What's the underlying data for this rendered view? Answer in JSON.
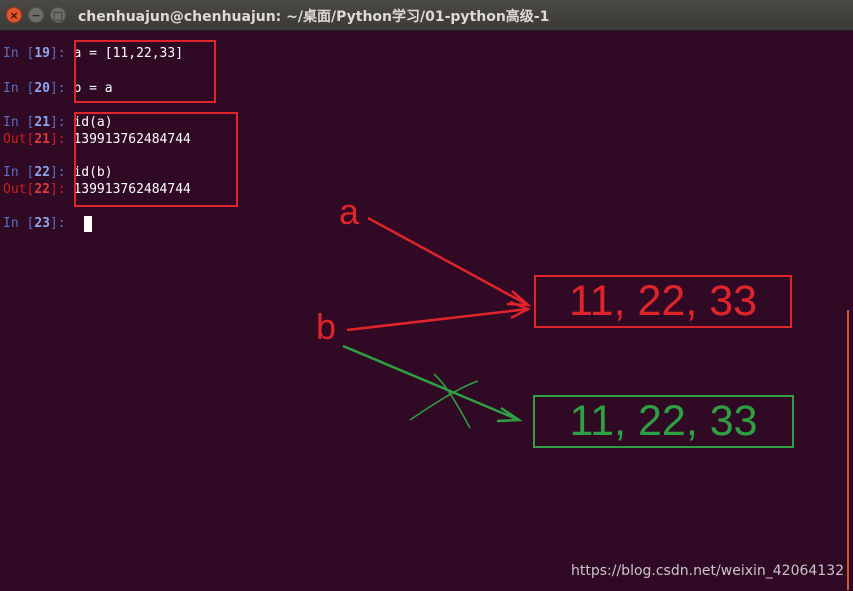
{
  "window": {
    "title": "chenhuajun@chenhuajun: ~/桌面/Python学习/01-python高级-1",
    "close_glyph": "×",
    "min_glyph": "−",
    "max_glyph": "□"
  },
  "terminal": {
    "lines": [
      {
        "in_prefix": "In [",
        "num": "19",
        "suffix": "]: ",
        "code": "a = [11,22,33]"
      },
      {
        "in_prefix": "In [",
        "num": "20",
        "suffix": "]: ",
        "code": "b = a"
      },
      {
        "in_prefix": "In [",
        "num": "21",
        "suffix": "]: ",
        "code": "id(a)"
      },
      {
        "out_prefix": "Out[",
        "num": "21",
        "suffix": "]: ",
        "value": "139913762484744"
      },
      {
        "in_prefix": "In [",
        "num": "22",
        "suffix": "]: ",
        "code": "id(b)"
      },
      {
        "out_prefix": "Out[",
        "num": "22",
        "suffix": "]: ",
        "value": "139913762484744"
      },
      {
        "in_prefix": "In [",
        "num": "23",
        "suffix": "]: ",
        "code": ""
      }
    ]
  },
  "annotations": {
    "label_a": "a",
    "label_b": "b",
    "red_values": "11, 22, 33",
    "green_values": "11, 22, 33",
    "red_color": "#e0242c",
    "green_color": "#2ea043"
  },
  "watermark": "https://blog.csdn.net/weixin_42064132"
}
